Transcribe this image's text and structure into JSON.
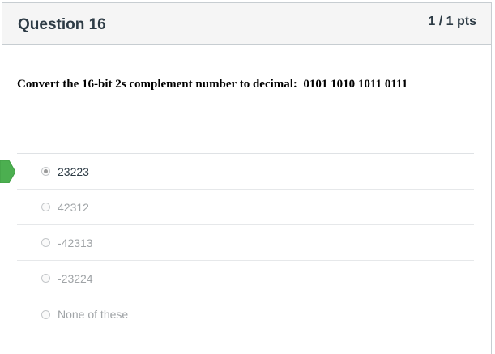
{
  "question": {
    "title": "Question 16",
    "points": "1 / 1 pts",
    "text": "Convert the 16-bit 2s complement number to decimal:  0101 1010 1011 0111"
  },
  "answers": [
    {
      "label": "23223",
      "selected": true,
      "correct": true
    },
    {
      "label": "42312",
      "selected": false
    },
    {
      "label": "-42313",
      "selected": false
    },
    {
      "label": "-23224",
      "selected": false
    },
    {
      "label": "None of these",
      "selected": false
    }
  ],
  "colors": {
    "correct_marker": "#4caf50",
    "header_bg": "#f5f5f5",
    "title_text": "#2d3b45",
    "unselected_answer_text": "#a0a4a7"
  },
  "icons": {
    "correct_marker": "correct-answer-arrow-icon"
  }
}
